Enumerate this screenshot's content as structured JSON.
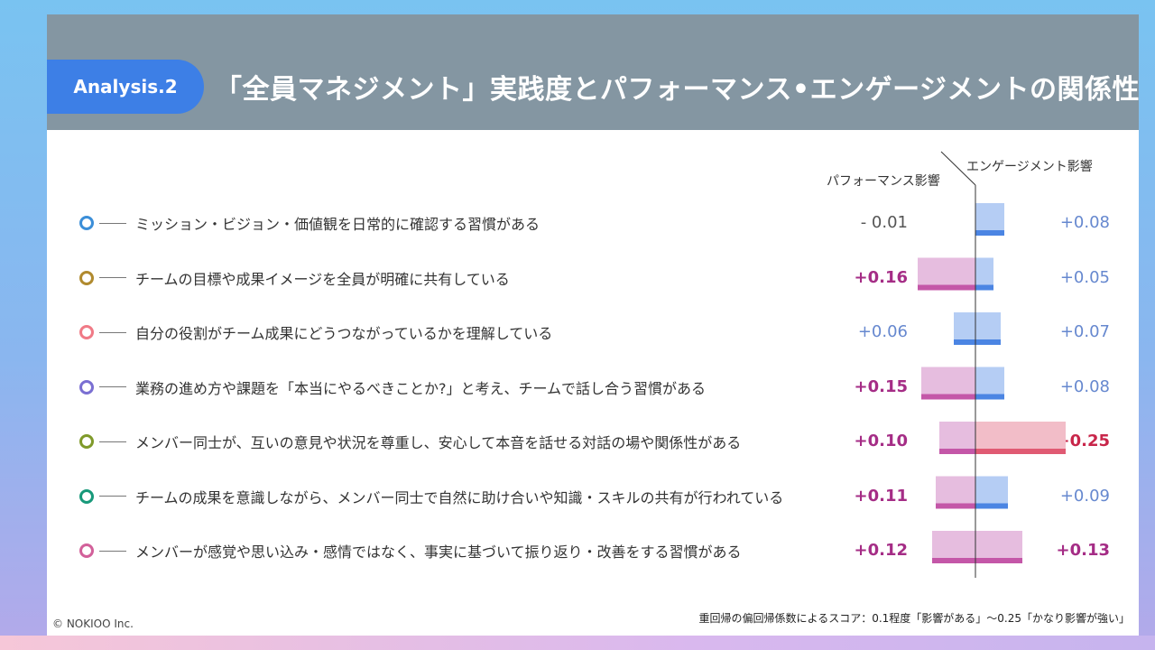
{
  "header": {
    "tag": "Analysis.2",
    "title": "「全員マネジメント」実践度とパフォーマンス•エンゲージメントの関係性"
  },
  "columns": {
    "performance": "パフォーマンス影響",
    "engagement": "エンゲージメント影響"
  },
  "chart_data": {
    "type": "bar",
    "orientation": "diverging-horizontal",
    "categories": [
      "ミッション・ビジョン・価値観を日常的に確認する習慣がある",
      "チームの目標や成果イメージを全員が明確に共有している",
      "自分の役割がチーム成果にどうつながっているかを理解している",
      "業務の進め方や課題を「本当にやるべきことか?」と考え、チームで話し合う習慣がある",
      "メンバー同士が、互いの意見や状況を尊重し、安心して本音を話せる対話の場や関係性がある",
      "チームの成果を意識しながら、メンバー同士で自然に助け合いや知識・スキルの共有が行われている",
      "メンバーが感覚や思い込み・感情ではなく、事実に基づいて振り返り・改善をする習慣がある"
    ],
    "series": [
      {
        "name": "パフォーマンス影響",
        "values": [
          -0.01,
          0.16,
          0.06,
          0.15,
          0.1,
          0.11,
          0.12
        ],
        "labels": [
          "- 0.01",
          "+0.16",
          "+0.06",
          "+0.15",
          "+0.10",
          "+0.11",
          "+0.12"
        ],
        "direction": "left"
      },
      {
        "name": "エンゲージメント影響",
        "values": [
          0.08,
          0.05,
          0.07,
          0.08,
          0.25,
          0.09,
          0.13
        ],
        "labels": [
          "+0.08",
          "+0.05",
          "+0.07",
          "+0.08",
          "+0.25",
          "+0.09",
          "+0.13"
        ],
        "direction": "right"
      }
    ],
    "xlim": [
      0,
      0.25
    ]
  },
  "row_colors": [
    "#3b8ed8",
    "#b08a2e",
    "#f07a86",
    "#7a6fd2",
    "#7f9a2a",
    "#18997a",
    "#d2609a"
  ],
  "colors": {
    "perf_strong_bar": "#e6bddf",
    "perf_strong_line": "#c457a8",
    "perf_strong_text": "#a52d86",
    "eng_bar": "#b5cdf4",
    "eng_line": "#4b85e3",
    "eng_text": "#6688cf",
    "eng_highlight_bar": "#f2bdc8",
    "eng_highlight_line": "#e05a73",
    "eng_highlight_text": "#c8264a",
    "neutral_text": "#555555"
  },
  "footnote": "重回帰の偏回帰係数によるスコア：0.1程度「影響がある」～0.25「かなり影響が強い」",
  "copyright": "© NOKIOO Inc."
}
